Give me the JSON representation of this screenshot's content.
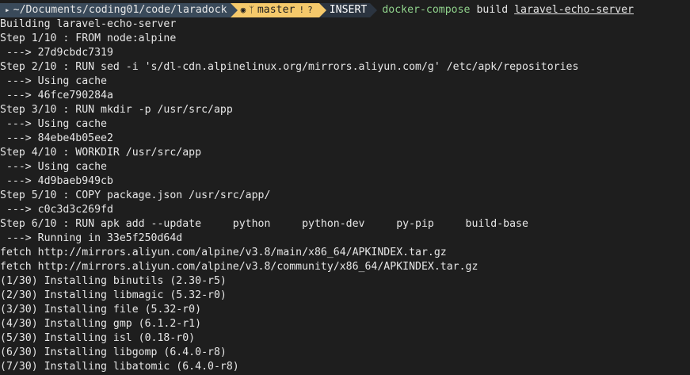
{
  "prompt": {
    "path_icon": "folder-icon",
    "path": "~/Documents/coding01/code/laradock",
    "git_icon": "github-icon",
    "branch_icon": "branch-icon",
    "branch": "master",
    "status_icon_1": "!",
    "status_icon_2": "?",
    "mode": "INSERT",
    "command": "docker-compose",
    "subcommand": "build",
    "argument": "laravel-echo-server"
  },
  "output": [
    "Building laravel-echo-server",
    "Step 1/10 : FROM node:alpine",
    " ---> 27d9cbdc7319",
    "Step 2/10 : RUN sed -i 's/dl-cdn.alpinelinux.org/mirrors.aliyun.com/g' /etc/apk/repositories",
    " ---> Using cache",
    " ---> 46fce790284a",
    "Step 3/10 : RUN mkdir -p /usr/src/app",
    " ---> Using cache",
    " ---> 84ebe4b05ee2",
    "Step 4/10 : WORKDIR /usr/src/app",
    " ---> Using cache",
    " ---> 4d9baeb949cb",
    "Step 5/10 : COPY package.json /usr/src/app/",
    " ---> c0c3d3c269fd",
    "Step 6/10 : RUN apk add --update     python     python-dev     py-pip     build-base",
    " ---> Running in 33e5f250d64d",
    "fetch http://mirrors.aliyun.com/alpine/v3.8/main/x86_64/APKINDEX.tar.gz",
    "fetch http://mirrors.aliyun.com/alpine/v3.8/community/x86_64/APKINDEX.tar.gz",
    "(1/30) Installing binutils (2.30-r5)",
    "(2/30) Installing libmagic (5.32-r0)",
    "(3/30) Installing file (5.32-r0)",
    "(4/30) Installing gmp (6.1.2-r1)",
    "(5/30) Installing isl (0.18-r0)",
    "(6/30) Installing libgomp (6.4.0-r8)",
    "(7/30) Installing libatomic (6.4.0-r8)"
  ],
  "colors": {
    "background": "#1e1e1e",
    "text": "#e6e6e6",
    "path_segment": "#3a4a5a",
    "git_segment": "#f5c96b",
    "mode_segment": "#2b3440",
    "command_green": "#8fd18b"
  }
}
